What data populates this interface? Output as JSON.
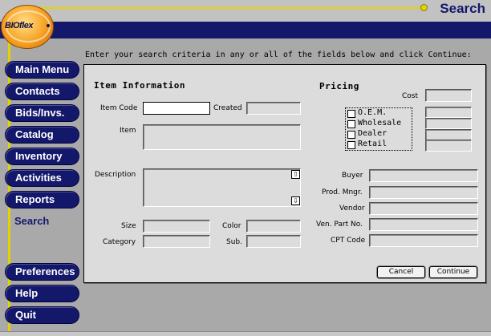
{
  "header": {
    "title": "Search",
    "logo_text": "BIOflex"
  },
  "sidebar": {
    "items": [
      {
        "label": "Main Menu"
      },
      {
        "label": "Contacts"
      },
      {
        "label": "Bids/Invs."
      },
      {
        "label": "Catalog"
      },
      {
        "label": "Inventory"
      },
      {
        "label": "Activities"
      },
      {
        "label": "Reports"
      },
      {
        "label": "Search"
      },
      {
        "label": "Preferences"
      },
      {
        "label": "Help"
      },
      {
        "label": "Quit"
      }
    ],
    "active": "Search"
  },
  "main": {
    "instruction": "Enter your search criteria in any or all of the fields below and click Continue:",
    "item_info": {
      "heading": "Item Information",
      "item_code_label": "Item Code",
      "item_code_value": "",
      "created_label": "Created",
      "created_value": "",
      "item_label": "Item",
      "item_value": "",
      "description_label": "Description",
      "description_value": "",
      "size_label": "Size",
      "size_value": "",
      "color_label": "Color",
      "color_value": "",
      "category_label": "Category",
      "category_value": "",
      "sub_label": "Sub.",
      "sub_value": ""
    },
    "pricing": {
      "heading": "Pricing",
      "cost_label": "Cost",
      "cost_value": "",
      "options": [
        {
          "label": "O.E.M.",
          "checked": false
        },
        {
          "label": "Wholesale",
          "checked": false
        },
        {
          "label": "Dealer",
          "checked": false
        },
        {
          "label": "Retail",
          "checked": false
        }
      ]
    },
    "vendor_info": {
      "buyer_label": "Buyer",
      "prod_mngr_label": "Prod. Mngr.",
      "vendor_label": "Vendor",
      "ven_part_label": "Ven. Part No.",
      "cpt_code_label": "CPT Code"
    },
    "buttons": {
      "cancel": "Cancel",
      "continue": "Continue"
    }
  },
  "colors": {
    "navy": "#14186b",
    "gold": "#e4d200",
    "panel": "#dcdcdc",
    "background": "#a9a9a9"
  }
}
